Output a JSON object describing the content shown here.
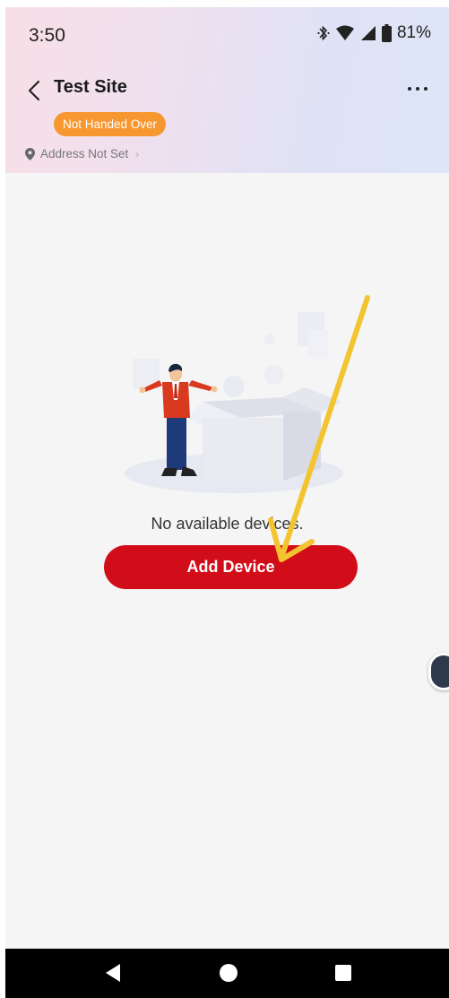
{
  "status_bar": {
    "time": "3:50",
    "battery_percent": "81%",
    "icons": [
      "bluetooth-icon",
      "wifi-icon",
      "signal-icon",
      "battery-icon"
    ]
  },
  "header": {
    "title": "Test Site",
    "badge": "Not Handed Over",
    "address": "Address Not Set",
    "back_icon": "chevron-left-icon",
    "more_icon": "more-horizontal-icon"
  },
  "empty_state": {
    "message": "No available devices.",
    "button_label": "Add Device",
    "illustration": "man-with-empty-box"
  },
  "annotation": {
    "arrow_color": "#f4c430"
  },
  "colors": {
    "accent": "#d20d1a",
    "badge": "#f6972f"
  },
  "nav_bar": {
    "buttons": [
      "back-triangle-icon",
      "home-circle-icon",
      "recents-square-icon"
    ]
  }
}
